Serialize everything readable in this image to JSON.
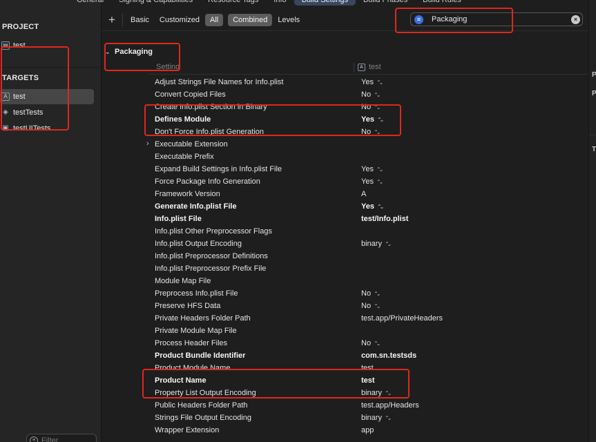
{
  "top_tabs": [
    "General",
    "Signing & Capabilities",
    "Resource Tags",
    "Info",
    "Build Settings",
    "Build Phases",
    "Build Rules"
  ],
  "top_tab_active": "Build Settings",
  "sidebar": {
    "project_header": "PROJECT",
    "project_item": "test",
    "targets_header": "TARGETS",
    "targets": [
      "test",
      "testTests",
      "testUITests"
    ],
    "filter_placeholder": "Filter"
  },
  "toolbar": {
    "add_label": "+",
    "basic": "Basic",
    "customized": "Customized",
    "all": "All",
    "combined": "Combined",
    "levels": "Levels",
    "search_value": "Packaging"
  },
  "section": {
    "title": "Packaging",
    "col_setting": "Setting",
    "col_target": "test"
  },
  "rows": [
    {
      "name": "Adjust Strings File Names for Info.plist",
      "value": "Yes",
      "stepper": true,
      "bold": false
    },
    {
      "name": "Convert Copied Files",
      "value": "No",
      "stepper": true,
      "bold": false
    },
    {
      "name": "Create Info.plist Section in Binary",
      "value": "No",
      "stepper": true,
      "bold": false
    },
    {
      "name": "Defines Module",
      "value": "Yes",
      "stepper": true,
      "bold": true
    },
    {
      "name": "Don't Force Info.plist Generation",
      "value": "No",
      "stepper": true,
      "bold": false
    },
    {
      "name": "Executable Extension",
      "value": "",
      "stepper": false,
      "bold": false,
      "disclosure": true
    },
    {
      "name": "Executable Prefix",
      "value": "",
      "stepper": false,
      "bold": false
    },
    {
      "name": "Expand Build Settings in Info.plist File",
      "value": "Yes",
      "stepper": true,
      "bold": false
    },
    {
      "name": "Force Package Info Generation",
      "value": "Yes",
      "stepper": true,
      "bold": false
    },
    {
      "name": "Framework Version",
      "value": "A",
      "stepper": false,
      "bold": false
    },
    {
      "name": "Generate Info.plist File",
      "value": "Yes",
      "stepper": true,
      "bold": true
    },
    {
      "name": "Info.plist File",
      "value": "test/Info.plist",
      "stepper": false,
      "bold": true
    },
    {
      "name": "Info.plist Other Preprocessor Flags",
      "value": "",
      "stepper": false,
      "bold": false
    },
    {
      "name": "Info.plist Output Encoding",
      "value": "binary",
      "stepper": true,
      "bold": false
    },
    {
      "name": "Info.plist Preprocessor Definitions",
      "value": "",
      "stepper": false,
      "bold": false
    },
    {
      "name": "Info.plist Preprocessor Prefix File",
      "value": "",
      "stepper": false,
      "bold": false
    },
    {
      "name": "Module Map File",
      "value": "",
      "stepper": false,
      "bold": false
    },
    {
      "name": "Preprocess Info.plist File",
      "value": "No",
      "stepper": true,
      "bold": false
    },
    {
      "name": "Preserve HFS Data",
      "value": "No",
      "stepper": true,
      "bold": false
    },
    {
      "name": "Private Headers Folder Path",
      "value": "test.app/PrivateHeaders",
      "stepper": false,
      "bold": false
    },
    {
      "name": "Private Module Map File",
      "value": "",
      "stepper": false,
      "bold": false
    },
    {
      "name": "Process Header Files",
      "value": "No",
      "stepper": true,
      "bold": false
    },
    {
      "name": "Product Bundle Identifier",
      "value": "com.sn.testsds",
      "stepper": false,
      "bold": true
    },
    {
      "name": "Product Module Name",
      "value": "test",
      "stepper": false,
      "bold": false
    },
    {
      "name": "Product Name",
      "value": "test",
      "stepper": false,
      "bold": true
    },
    {
      "name": "Property List Output Encoding",
      "value": "binary",
      "stepper": true,
      "bold": false
    },
    {
      "name": "Public Headers Folder Path",
      "value": "test.app/Headers",
      "stepper": false,
      "bold": false
    },
    {
      "name": "Strings File Output Encoding",
      "value": "binary",
      "stepper": true,
      "bold": false
    },
    {
      "name": "Wrapper Extension",
      "value": "app",
      "stepper": false,
      "bold": false
    }
  ],
  "right_panel_glyphs": [
    "P",
    "P",
    "T"
  ],
  "colors": {
    "annotation": "#e0271e",
    "search_accent": "#3b6fe0",
    "selected_segment": "#5c5c5c",
    "active_tab": "#3a4560"
  }
}
